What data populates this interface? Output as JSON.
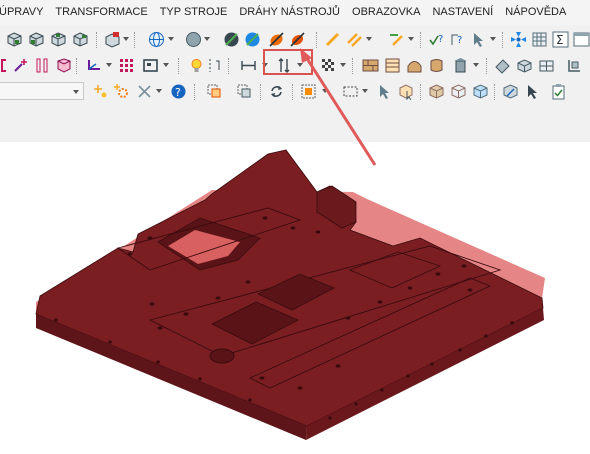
{
  "menu": {
    "items": [
      "ÚPRAVY",
      "TRANSFORMACE",
      "TYP STROJE",
      "DRÁHY NÁSTROJŮ",
      "OBRAZOVKA",
      "NASTAVENÍ",
      "NÁPOVĚDA"
    ]
  },
  "toolbar": {
    "combo_value": "",
    "highlighted_group": [
      "stock-model-icon",
      "stock-model-shaded-icon"
    ]
  },
  "colors": {
    "part": "#7a1e22",
    "part_edge": "#3a0b0d",
    "stock_overlay": "#e07070",
    "highlight_frame": "#d9534f",
    "arrow": "#e05a5a"
  }
}
